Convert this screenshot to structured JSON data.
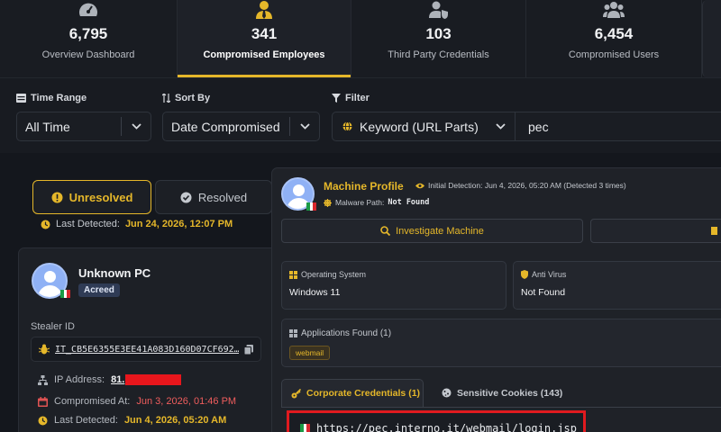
{
  "stats": [
    {
      "icon": "gauge-icon",
      "value": "6,795",
      "label": "Overview Dashboard"
    },
    {
      "icon": "employee-icon",
      "value": "341",
      "label": "Compromised Employees",
      "active": true
    },
    {
      "icon": "user-shield-icon",
      "value": "103",
      "label": "Third Party Credentials"
    },
    {
      "icon": "users-icon",
      "value": "6,454",
      "label": "Compromised Users"
    }
  ],
  "filters": {
    "time_range": {
      "label": "Time Range",
      "value": "All Time"
    },
    "sort_by": {
      "label": "Sort By",
      "value": "Date Compromised"
    },
    "filter": {
      "label": "Filter",
      "type": "Keyword (URL Parts)",
      "query": "pec"
    }
  },
  "status_tabs": {
    "unresolved": "Unresolved",
    "resolved": "Resolved"
  },
  "left": {
    "last_detected_label": "Last Detected:",
    "last_detected_value": "Jun 24, 2026, 12:07 PM",
    "machine_name": "Unknown PC",
    "badge": "Acreed",
    "stealer_label": "Stealer ID",
    "stealer_id": "IT_CB5E6355E3EE41A083D160D07CF692…",
    "ip_label": "IP Address:",
    "ip_value": "81.",
    "compromised_label": "Compromised At:",
    "compromised_value": "Jun 3, 2026, 01:46 PM",
    "detected_label": "Last Detected:",
    "detected_value": "Jun 4, 2026, 05:20 AM"
  },
  "profile": {
    "title": "Machine Profile",
    "initial_detection": "Initial Detection: Jun 4, 2026, 05:20 AM (Detected 3 times)",
    "malware_label": "Malware Path:",
    "malware_value": "Not Found",
    "investigate": "Investigate Machine",
    "os_label": "Operating System",
    "os_value": "Windows 11",
    "av_label": "Anti Virus",
    "av_value": "Not Found",
    "apps_label": "Applications Found (1)",
    "apps": [
      "webmail"
    ],
    "tab_corporate": "Corporate Credentials (1)",
    "tab_cookies": "Sensitive Cookies (143)",
    "url": "https://pec.interno.it/webmail/login.jsp"
  },
  "colors": {
    "accent": "#e5b72a",
    "danger": "#e01a1f",
    "background": "#14171d"
  }
}
